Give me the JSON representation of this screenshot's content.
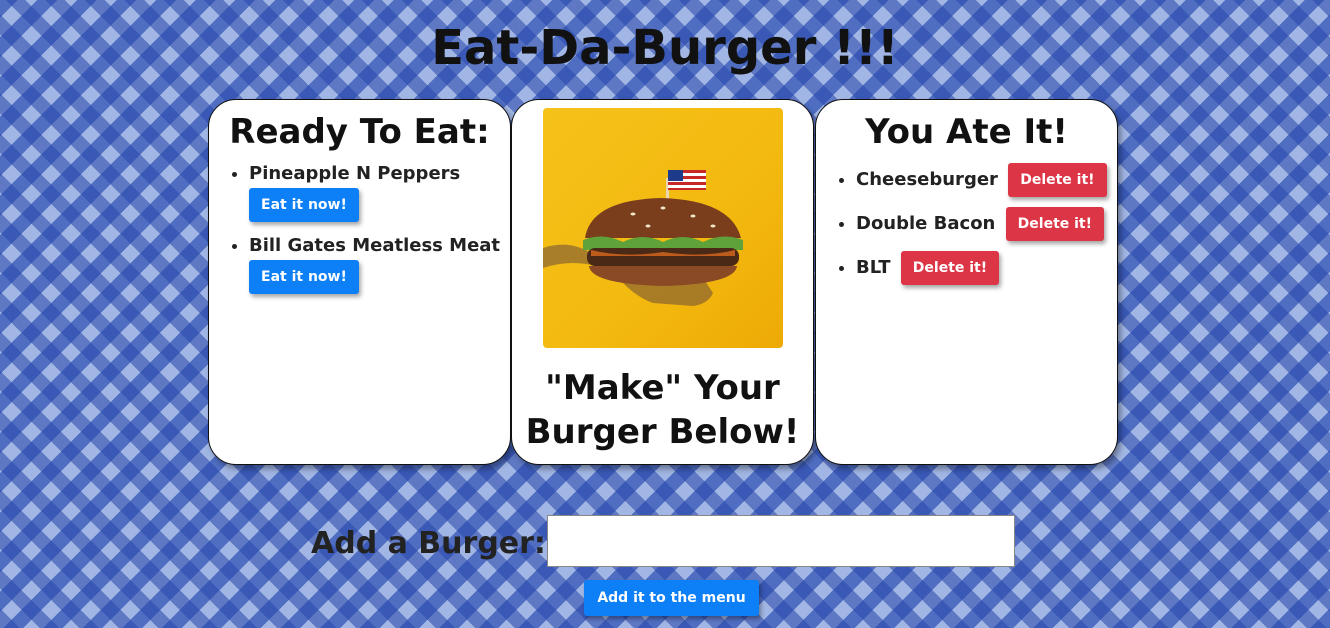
{
  "header": {
    "title": "Eat-Da-Burger !!!"
  },
  "ready_panel": {
    "heading": "Ready To Eat:",
    "items": [
      {
        "name": "Pineapple N Peppers",
        "button_label": "Eat it now!"
      },
      {
        "name": "Bill Gates Meatless Meat",
        "button_label": "Eat it now!"
      }
    ]
  },
  "center_panel": {
    "image_alt": "burger-photo",
    "caption_line1": "\"Make\" Your",
    "caption_line2": "Burger Below!"
  },
  "eaten_panel": {
    "heading": "You Ate It!",
    "items": [
      {
        "name": "Cheeseburger",
        "button_label": "Delete it!"
      },
      {
        "name": "Double Bacon",
        "button_label": "Delete it!"
      },
      {
        "name": "BLT",
        "button_label": "Delete it!"
      }
    ]
  },
  "add_form": {
    "label": "Add a Burger:",
    "input_value": "",
    "input_placeholder": "",
    "submit_label": "Add it to the menu"
  },
  "colors": {
    "primary_button": "#0d7ff7",
    "danger_button": "#dc3545",
    "background_plaid": "#6f8fd6",
    "image_background": "#f5c21a"
  }
}
